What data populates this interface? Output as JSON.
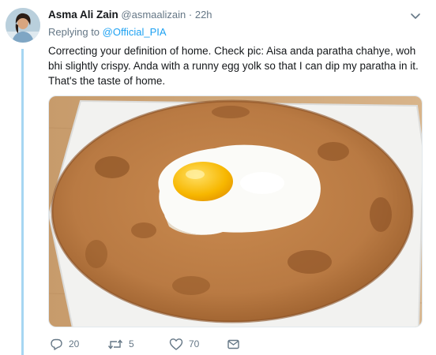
{
  "tweet": {
    "display_name": "Asma Ali Zain",
    "handle": "@asmaalizain",
    "separator": "·",
    "time": "22h",
    "replying_prefix": "Replying to",
    "replying_to": "@Official_PIA",
    "text": "Correcting your definition of home. Check pic: Aisa anda paratha chahye, woh bhi slightly crispy. Anda with a runny egg yolk so that I can dip my paratha in it. That's the taste of home."
  },
  "actions": {
    "reply_count": "20",
    "retweet_count": "5",
    "like_count": "70"
  },
  "icons": {
    "reply": "reply-icon",
    "retweet": "retweet-icon",
    "like": "like-icon",
    "message": "direct-message-icon",
    "menu": "chevron-down-icon"
  },
  "colors": {
    "link": "#1da1f2",
    "muted": "#657786",
    "thread_line": "#a6d6f2"
  }
}
